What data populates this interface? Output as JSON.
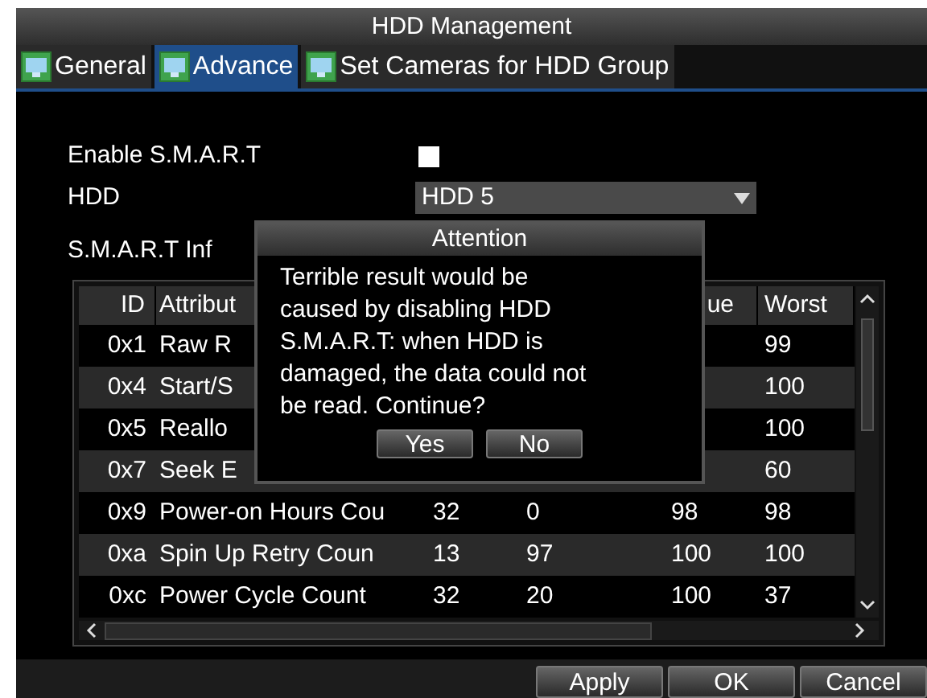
{
  "window": {
    "title": "HDD Management"
  },
  "tabs": [
    {
      "label": "General",
      "selected": false
    },
    {
      "label": "Advance",
      "selected": true
    },
    {
      "label": "Set Cameras for HDD Group",
      "selected": false
    }
  ],
  "enable_smart": {
    "label": "Enable S.M.A.R.T",
    "checked": false
  },
  "hdd": {
    "label": "HDD",
    "value": "HDD 5"
  },
  "smart_info": {
    "label": "S.M.A.R.T Inf"
  },
  "table": {
    "columns": [
      {
        "label": "ID"
      },
      {
        "label": "Attribut"
      },
      {},
      {},
      {
        "label": "ue"
      },
      {
        "label": "Worst"
      }
    ],
    "rows": [
      {
        "cells": [
          "0x1",
          "Raw R",
          null,
          null,
          null,
          "99"
        ]
      },
      {
        "cells": [
          "0x4",
          "Start/S",
          null,
          null,
          null,
          "100"
        ]
      },
      {
        "cells": [
          "0x5",
          "Reallo",
          null,
          null,
          null,
          "100"
        ]
      },
      {
        "cells": [
          "0x7",
          "Seek E",
          null,
          null,
          null,
          "60"
        ]
      },
      {
        "cells": [
          "0x9",
          "Power-on Hours Cou",
          "32",
          "0",
          "98",
          "98"
        ]
      },
      {
        "cells": [
          "0xa",
          "Spin Up Retry Coun",
          "13",
          "97",
          "100",
          "100"
        ]
      },
      {
        "cells": [
          "0xc",
          "Power Cycle Count",
          "32",
          "20",
          "100",
          "37"
        ]
      }
    ]
  },
  "dialog": {
    "title": "Attention",
    "message": "Terrible result would be caused by disabling HDD S.M.A.R.T: when HDD is damaged, the data could not be read. Continue?",
    "buttons": [
      "Yes",
      "No"
    ]
  },
  "buttons": [
    "Apply",
    "OK",
    "Cancel"
  ]
}
